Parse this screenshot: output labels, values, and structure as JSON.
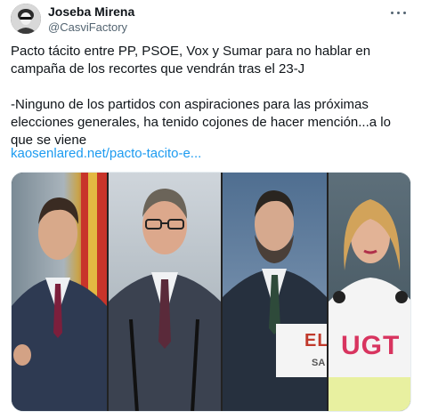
{
  "author": {
    "name": "Joseba Mirena",
    "handle": "@CasviFactory"
  },
  "tweet": {
    "paragraph1": "Pacto tácito entre PP, PSOE, Vox y Sumar para no hablar en campaña de los recortes que vendrán tras el 23-J",
    "paragraph2": "-Ninguno de los partidos con aspiraciones para las próximas elecciones generales, ha tenido cojones de hacer mención...a lo que se viene",
    "link_text": "kaosenlared.net/pacto-tacito-e..."
  },
  "media": {
    "panel3_sign_text": "ELC",
    "panel3_sign_sub": "SA",
    "panel4_shirt_text": "UGT"
  },
  "colors": {
    "link": "#1d9bf0",
    "text": "#0f1419",
    "secondary": "#536471"
  },
  "icons": {
    "more": "more-horizontal-icon"
  }
}
